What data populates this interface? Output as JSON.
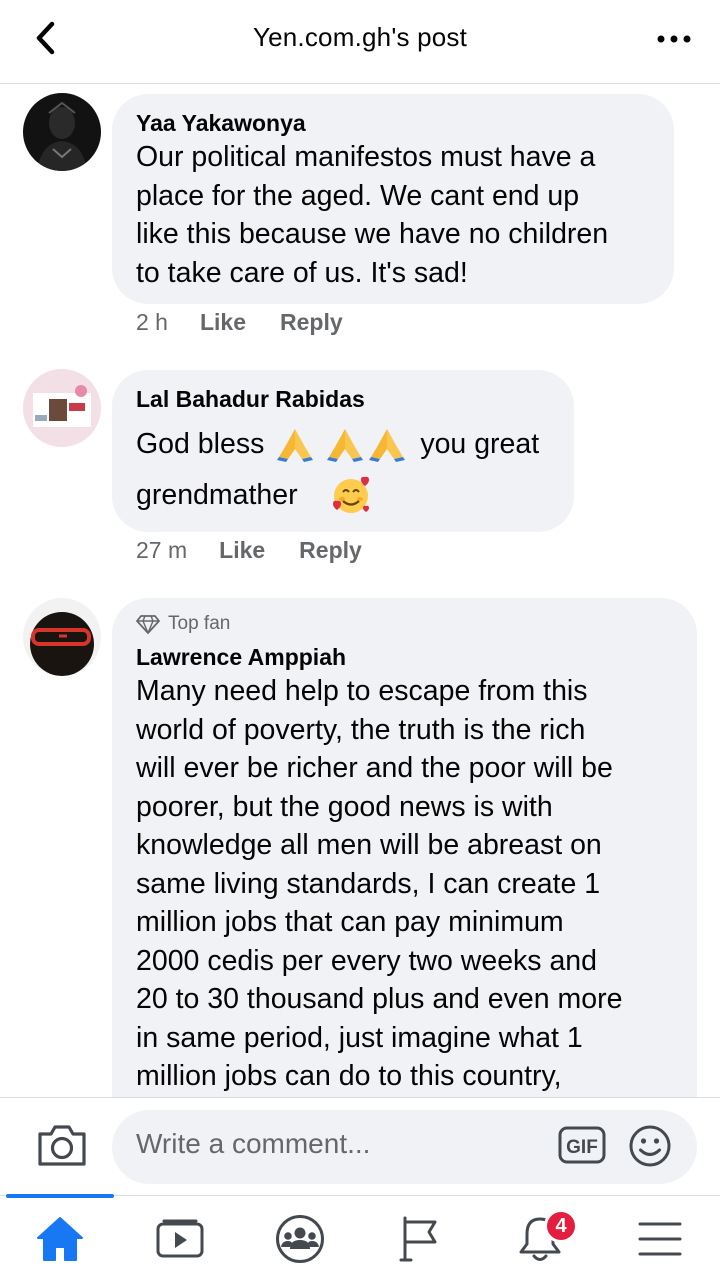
{
  "header": {
    "title": "Yen.com.gh's post"
  },
  "comments": [
    {
      "author": "Yaa Yakawonya",
      "lines": [
        "Our political manifestos must have a",
        "place for the aged. We cant end up",
        "like this because we have no children",
        "to take care of us. It's sad!"
      ],
      "time": "2 h",
      "like": "Like",
      "reply": "Reply"
    },
    {
      "author": "Lal Bahadur Rabidas",
      "line1_text_a": "God bless",
      "line1_text_b": "you great",
      "line2_text": "grendmather",
      "time": "27 m",
      "like": "Like",
      "reply": "Reply"
    },
    {
      "badge": "Top fan",
      "author": "Lawrence Amppiah",
      "lines": [
        "Many need help to escape from this",
        "world of poverty, the truth is the rich",
        "will ever be richer and the poor will be",
        "poorer, but the good news is with",
        "knowledge all men will be abreast on",
        "same living standards, I can create 1",
        "million jobs that can pay minimum",
        "2000 cedis per every two weeks and",
        "20 to 30 thousand plus and even more",
        "in same period, just imagine what 1",
        "million jobs can do to this country,"
      ]
    }
  ],
  "composer": {
    "placeholder": "Write a comment...",
    "gif_label": "GIF"
  },
  "nav": {
    "notifications_count": "4"
  },
  "colors": {
    "accent": "#1877f2",
    "bubble": "#f0f2f5",
    "badge": "#e41e3f",
    "meta_text": "#65676b"
  }
}
